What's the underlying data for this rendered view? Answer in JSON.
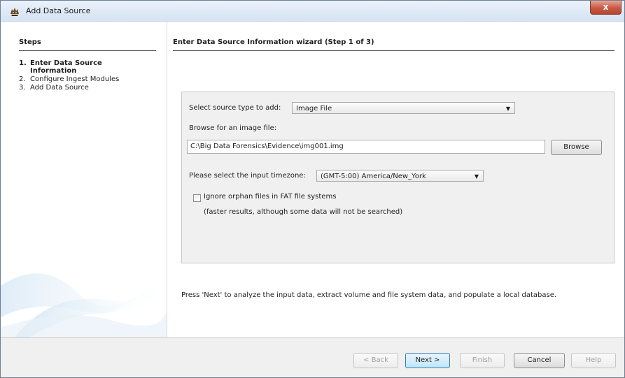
{
  "window": {
    "title": "Add Data Source",
    "close_glyph": "x"
  },
  "steps": {
    "header": "Steps",
    "items": [
      {
        "num": "1.",
        "label_line1": "Enter Data Source",
        "label_line2": "Information"
      },
      {
        "num": "2.",
        "label": "Configure Ingest Modules"
      },
      {
        "num": "3.",
        "label": "Add Data Source"
      }
    ]
  },
  "wizard": {
    "header": "Enter Data Source Information wizard (Step 1 of 3)",
    "source_type_label": "Select source type to add:",
    "source_type_value": "Image File",
    "browse_label": "Browse for an image file:",
    "image_path": "C:\\Big Data Forensics\\Evidence\\img001.img",
    "browse_button": "Browse",
    "timezone_label": "Please select the input timezone:",
    "timezone_value": "(GMT-5:00) America/New_York",
    "orphan_checkbox_label": "Ignore orphan files in FAT file systems",
    "orphan_checked": false,
    "orphan_hint": "(faster results, although some data will not be searched)",
    "instruction": "Press 'Next' to analyze the input data, extract volume and file system data, and populate a local database."
  },
  "buttons": {
    "back": "< Back",
    "next": "Next >",
    "finish": "Finish",
    "cancel": "Cancel",
    "help": "Help"
  },
  "icons": {
    "app": "autopsy-dog-icon",
    "dropdown": "chevron-down-icon",
    "close": "close-icon"
  },
  "colors": {
    "titlebar": "#dbe6f4",
    "close_button": "#c75a45",
    "default_button": "#bee6fd"
  }
}
